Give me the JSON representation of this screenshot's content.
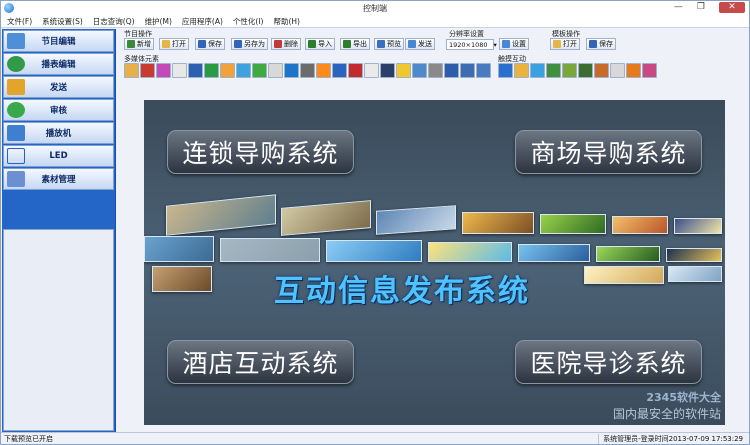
{
  "window": {
    "title": "控制端"
  },
  "menu": [
    "文件(F)",
    "系统设置(S)",
    "日志查询(Q)",
    "维护(M)",
    "应用程序(A)",
    "个性化(I)",
    "帮助(H)"
  ],
  "sidebar": {
    "items": [
      {
        "label": "节目编辑",
        "icon": "edit-icon",
        "color": "#4f8fd8"
      },
      {
        "label": "播表编辑",
        "icon": "globe-icon",
        "color": "#2f9b49"
      },
      {
        "label": "发送",
        "icon": "send-icon",
        "color": "#e0a52a"
      },
      {
        "label": "审核",
        "icon": "audit-icon",
        "color": "#3aa84b"
      },
      {
        "label": "播放机",
        "icon": "player-icon",
        "color": "#3f7fd0"
      },
      {
        "label": "LED",
        "icon": "led-icon",
        "color": "#2a5fc0"
      },
      {
        "label": "素材管理",
        "icon": "material-icon",
        "color": "#6c8fd1"
      }
    ]
  },
  "toolbar": {
    "program_ops_label": "节目操作",
    "program_ops": [
      {
        "label": "新增",
        "icon": "new-icon",
        "color": "#3a8a3a"
      },
      {
        "label": "打开",
        "icon": "open-folder-icon",
        "color": "#e3b54a"
      },
      {
        "label": "保存",
        "icon": "save-icon",
        "color": "#3464b8"
      },
      {
        "label": "另存为",
        "icon": "save-as-icon",
        "color": "#3464b8"
      },
      {
        "label": "删除",
        "icon": "delete-icon",
        "color": "#c23b3b"
      },
      {
        "label": "导入",
        "icon": "import-icon",
        "color": "#2d7d2d"
      },
      {
        "label": "导出",
        "icon": "export-icon",
        "color": "#2d7d2d"
      },
      {
        "label": "预览",
        "icon": "preview-icon",
        "color": "#3a6fc0"
      },
      {
        "label": "发送",
        "icon": "send-icon",
        "color": "#4a86d6"
      }
    ],
    "resolution_label": "分辨率设置",
    "resolution_value": "1920×1080",
    "settings_label": "设置",
    "template_label": "模板操作",
    "template_open": "打开",
    "template_save": "保存",
    "media_label": "多媒体元素",
    "media_icons": [
      "#e8b04a",
      "#c93a2f",
      "#c34ab8",
      "#e8e8e8",
      "#2e5fb0",
      "#2a9a45",
      "#f2a23a",
      "#3fa2e0",
      "#3faa3f",
      "#d8d8d8",
      "#1d74c9",
      "#6c6c6c",
      "#ff8a1c",
      "#2b63c0",
      "#c22c2c",
      "#eaeaea",
      "#2c3f6a",
      "#f0c72c",
      "#4e8ac9",
      "#8a8a8a",
      "#2f5ea8",
      "#3d6db0",
      "#4a7ac0"
    ],
    "touch_label": "触摸互动",
    "touch_icons": [
      "#2a6fd0",
      "#e9b43d",
      "#3aa0e0",
      "#3f8f3f",
      "#7aa63a",
      "#3c6f2f",
      "#c86a2a",
      "#d8d8d8",
      "#e87a1e",
      "#c94a82"
    ]
  },
  "stage": {
    "pill_top_left": "连锁导购系统",
    "pill_top_right": "商场导购系统",
    "pill_bottom_left": "酒店互动系统",
    "pill_bottom_right": "医院导诊系统",
    "banner": "互动信息发布系统",
    "watermark_site": "2345软件大全",
    "watermark_slogan": "国内最安全的软件站"
  },
  "status": {
    "left": "下载预览已开启",
    "right": "系统管理员-登录时间2013-07-09 17:53:29"
  }
}
